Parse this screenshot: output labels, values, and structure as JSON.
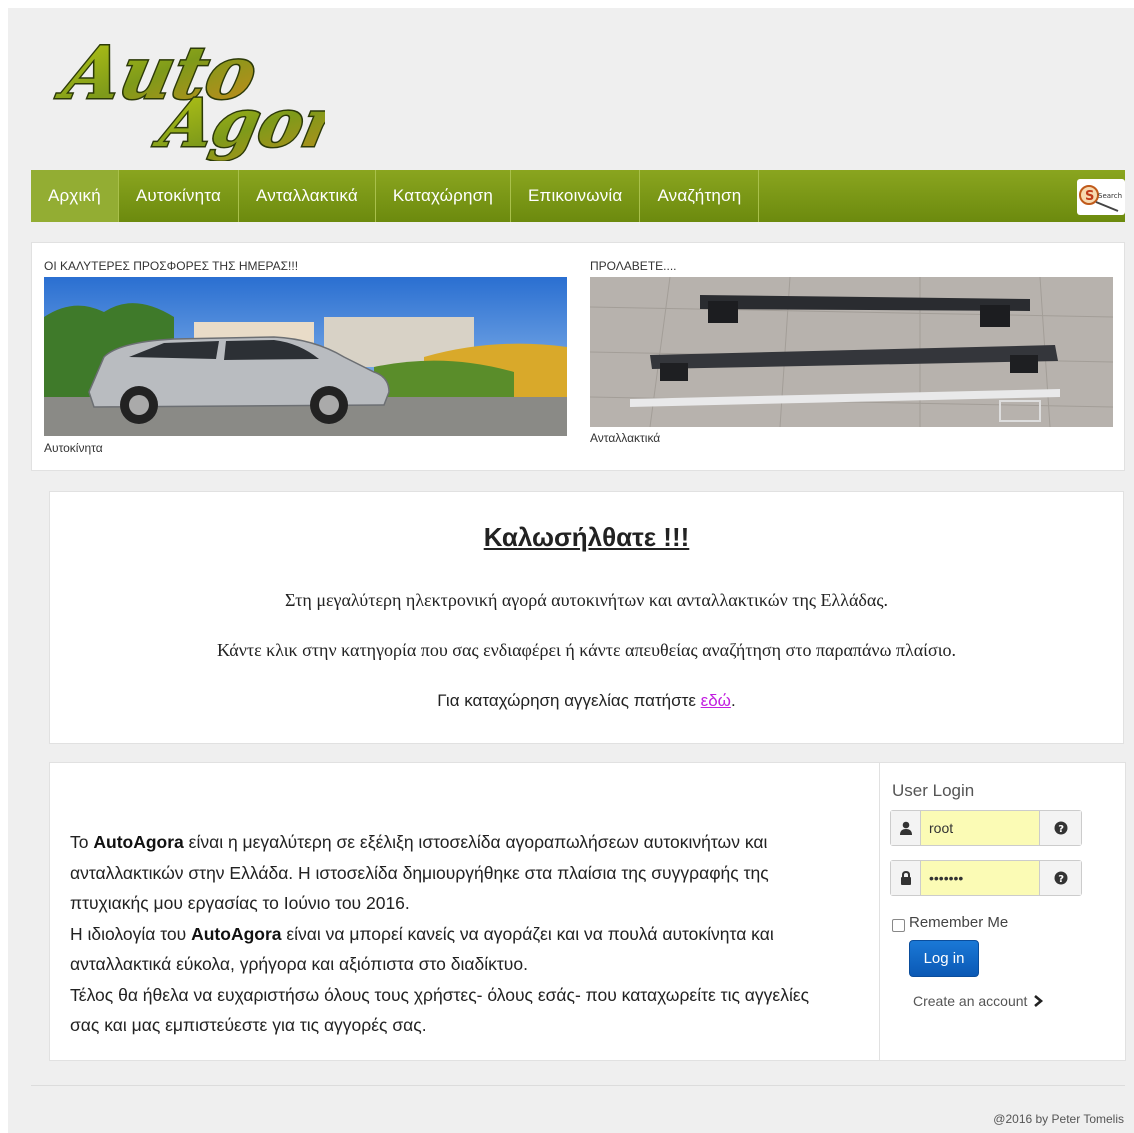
{
  "logo": {
    "line1": "Auto",
    "line2": "Agora"
  },
  "nav": {
    "items": [
      "Αρχική",
      "Αυτοκίνητα",
      "Ανταλλακτικά",
      "Καταχώρηση",
      "Επικοινωνία",
      "Αναζήτηση"
    ],
    "search_label": "Search"
  },
  "offers": {
    "left": {
      "title": "ΟΙ ΚΑΛΥΤΕΡΕΣ ΠΡΟΣΦΟΡΕΣ ΤΗΣ ΗΜΕΡΑΣ!!!",
      "caption": "Αυτοκίνητα"
    },
    "right": {
      "title": "ΠΡΟΛΑΒΕΤΕ....",
      "caption": "Ανταλλακτικά"
    }
  },
  "welcome": {
    "heading": "Καλωσήλθατε !!!",
    "line1": "Στη μεγαλύτερη ηλεκτρονική αγορά αυτοκινήτων και ανταλλακτικών της Ελλάδας.",
    "line2": "Κάντε κλικ στην κατηγορία που σας ενδιαφέρει ή κάντε απευθείας αναζήτηση στο παραπάνω πλαίσιο.",
    "line3_prefix": "Για καταχώρηση αγγελίας πατήστε ",
    "line3_link": "εδώ",
    "line3_suffix": "."
  },
  "about": {
    "p1_prefix": "Το ",
    "brand": "AutoAgora",
    "p1_suffix": " είναι η μεγαλύτερη σε εξέλιξη ιστοσελίδα αγοραπωλήσεων αυτοκινήτων και ανταλλακτικών στην Ελλάδα. Η ιστοσελίδα δημιουργήθηκε στα πλαίσια της συγγραφής της πτυχιακής μου εργασίας το Ιούνιο του 2016.",
    "p2_prefix": "Η ιδιολογία του ",
    "p2_suffix": " είναι να μπορεί κανείς να αγοράζει και να πουλά αυτοκίνητα και ανταλλακτικά εύκολα, γρήγορα και αξιόπιστα στο διαδίκτυο.",
    "p3": "Τέλος θα ήθελα να ευχαριστήσω όλους τους χρήστες- όλους εσάς- που καταχωρείτε τις αγγελίες σας και μας εμπιστεύεστε για τις αγγορές σας."
  },
  "login": {
    "title": "User Login",
    "username": "root",
    "password": "•••••••",
    "remember": "Remember Me",
    "button": "Log in",
    "create": "Create an account"
  },
  "footer": {
    "text": "@2016 by Peter Tomelis"
  },
  "colors": {
    "nav": "#7a9617",
    "link": "#c21ee0",
    "button": "#0b63c4",
    "field": "#fbfbb5"
  }
}
